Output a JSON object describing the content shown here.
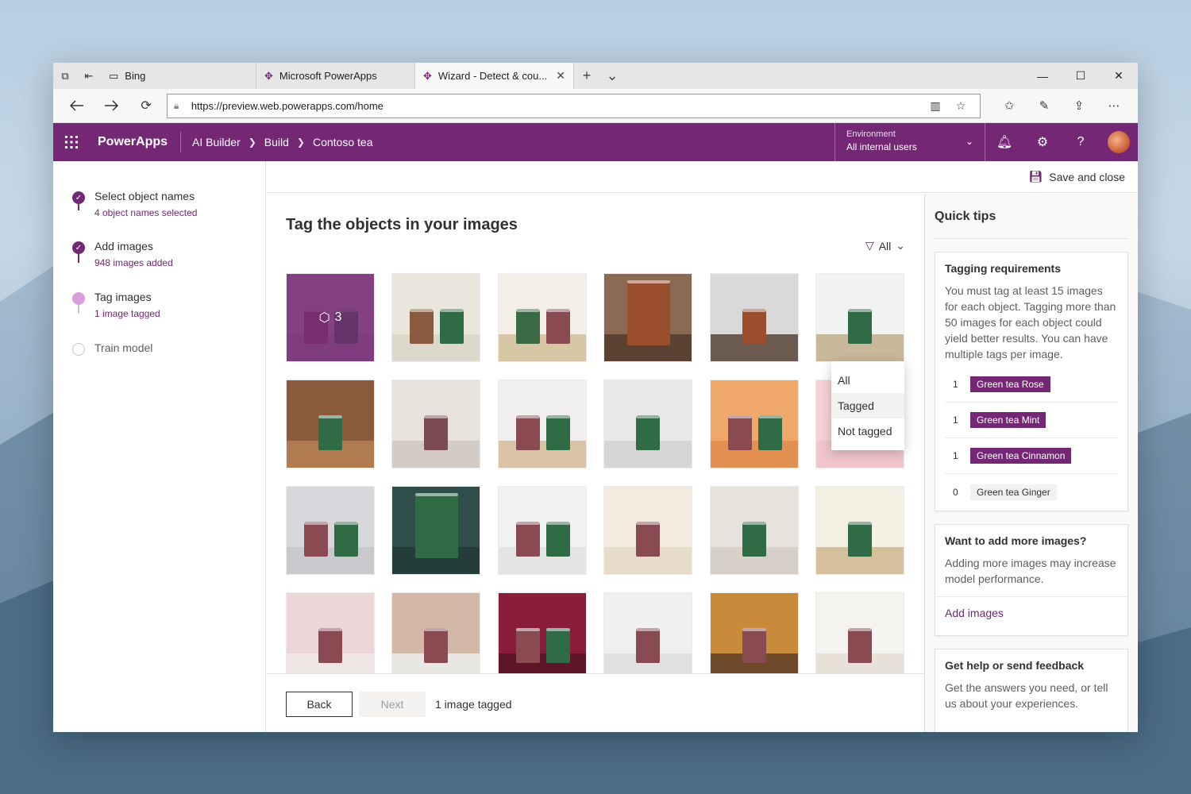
{
  "browser": {
    "tabs": [
      {
        "label": "Bing",
        "icon": "bing-icon",
        "active": false
      },
      {
        "label": "Microsoft PowerApps",
        "icon": "powerapps-icon",
        "active": false
      },
      {
        "label": "Wizard - Detect & cou...",
        "icon": "powerapps-icon",
        "active": true
      }
    ],
    "url": "https://preview.web.powerapps.com/home"
  },
  "app": {
    "brand": "PowerApps",
    "breadcrumb": [
      "AI Builder",
      "Build",
      "Contoso tea"
    ],
    "environment_label": "Environment",
    "environment_value": "All internal users",
    "accent": "#742774"
  },
  "steps": [
    {
      "title": "Select object names",
      "sub": "4 object names selected",
      "state": "done"
    },
    {
      "title": "Add images",
      "sub": "948 images added",
      "state": "done"
    },
    {
      "title": "Tag images",
      "sub": "1 image tagged",
      "state": "current"
    },
    {
      "title": "Train model",
      "sub": "",
      "state": "pending"
    }
  ],
  "toolbar": {
    "save_close": "Save and close"
  },
  "main": {
    "title": "Tag the objects in your images",
    "filter_value": "All",
    "tagged_tile_count": "3",
    "filter_options": [
      "All",
      "Tagged",
      "Not tagged"
    ],
    "hovered_option": "Tagged"
  },
  "footer": {
    "back": "Back",
    "next": "Next",
    "status": "1 image tagged"
  },
  "tips": {
    "title": "Quick tips",
    "req_title": "Tagging requirements",
    "req_text": "You must tag at least 15 images for each object. Tagging more than 50 images for each object could yield better results. You can have multiple tags per image.",
    "tags": [
      {
        "count": "1",
        "name": "Green tea Rose",
        "active": true
      },
      {
        "count": "1",
        "name": "Green tea Mint",
        "active": true
      },
      {
        "count": "1",
        "name": "Green tea Cinnamon",
        "active": true
      },
      {
        "count": "0",
        "name": "Green tea Ginger",
        "active": false
      }
    ],
    "more_title": "Want to add more images?",
    "more_text": "Adding more images may increase model performance.",
    "more_link": "Add images",
    "help_title": "Get help or send feedback",
    "help_text": "Get the answers you need, or tell us about your experiences."
  }
}
